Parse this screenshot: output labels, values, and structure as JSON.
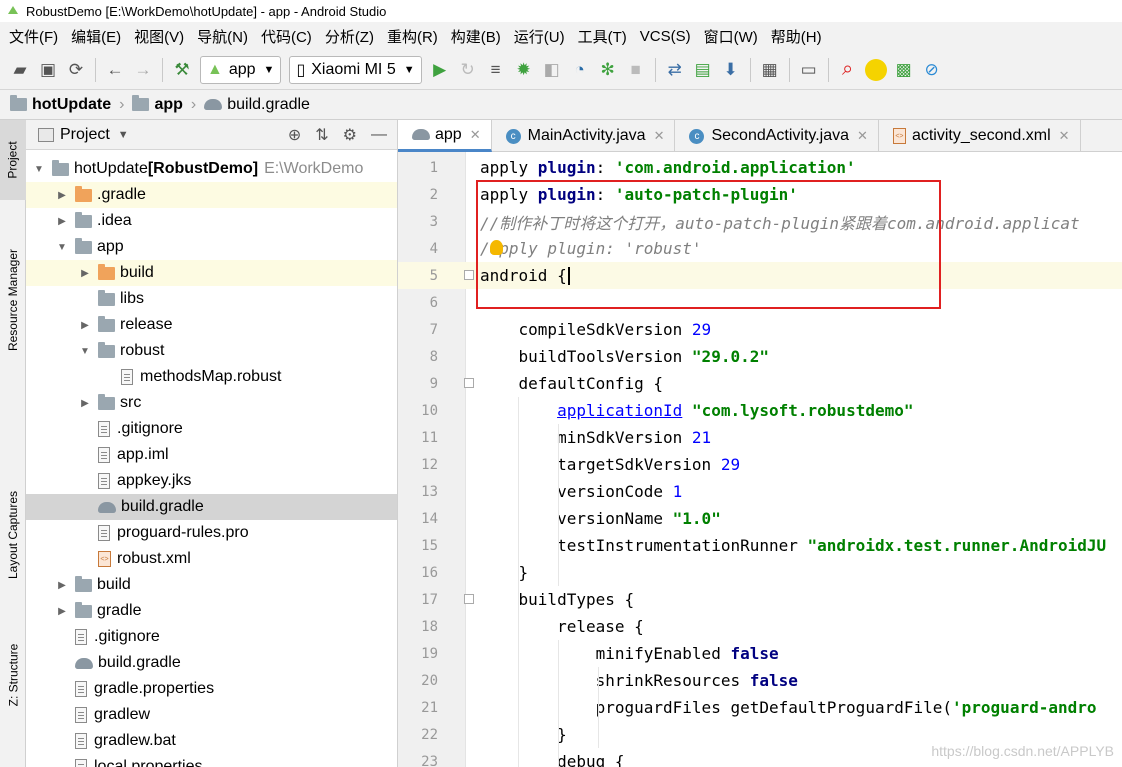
{
  "window": {
    "title": "RobustDemo [E:\\WorkDemo\\hotUpdate] - app - Android Studio"
  },
  "menu": [
    "文件(F)",
    "编辑(E)",
    "视图(V)",
    "导航(N)",
    "代码(C)",
    "分析(Z)",
    "重构(R)",
    "构建(B)",
    "运行(U)",
    "工具(T)",
    "VCS(S)",
    "窗口(W)",
    "帮助(H)"
  ],
  "toolbar": {
    "run_config": "app",
    "device": "Xiaomi MI 5"
  },
  "breadcrumb": [
    "hotUpdate",
    "app",
    "build.gradle"
  ],
  "left_tabs": [
    "Project",
    "Resource Manager",
    "Layout Captures",
    "Z: Structure"
  ],
  "project": {
    "header": "Project",
    "tree": [
      {
        "name": "hotUpdate",
        "bold": "[RobustDemo]",
        "path": "E:\\WorkDemo",
        "level": 0,
        "arrow": "open",
        "icon": "folder"
      },
      {
        "name": ".gradle",
        "level": 1,
        "arrow": "closed",
        "icon": "folder-orange",
        "hl": true
      },
      {
        "name": ".idea",
        "level": 1,
        "arrow": "closed",
        "icon": "folder"
      },
      {
        "name": "app",
        "level": 1,
        "arrow": "open",
        "icon": "folder"
      },
      {
        "name": "build",
        "level": 2,
        "arrow": "closed",
        "icon": "folder-orange",
        "hl": true
      },
      {
        "name": "libs",
        "level": 2,
        "arrow": "",
        "icon": "folder"
      },
      {
        "name": "release",
        "level": 2,
        "arrow": "closed",
        "icon": "folder"
      },
      {
        "name": "robust",
        "level": 2,
        "arrow": "open",
        "icon": "folder"
      },
      {
        "name": "methodsMap.robust",
        "level": 3,
        "arrow": "",
        "icon": "unknown"
      },
      {
        "name": "src",
        "level": 2,
        "arrow": "closed",
        "icon": "folder"
      },
      {
        "name": ".gitignore",
        "level": 2,
        "arrow": "",
        "icon": "file"
      },
      {
        "name": "app.iml",
        "level": 2,
        "arrow": "",
        "icon": "file"
      },
      {
        "name": "appkey.jks",
        "level": 2,
        "arrow": "",
        "icon": "file"
      },
      {
        "name": "build.gradle",
        "level": 2,
        "arrow": "",
        "icon": "gradle",
        "sel": true
      },
      {
        "name": "proguard-rules.pro",
        "level": 2,
        "arrow": "",
        "icon": "file"
      },
      {
        "name": "robust.xml",
        "level": 2,
        "arrow": "",
        "icon": "xml"
      },
      {
        "name": "build",
        "level": 1,
        "arrow": "closed",
        "icon": "folder"
      },
      {
        "name": "gradle",
        "level": 1,
        "arrow": "closed",
        "icon": "folder"
      },
      {
        "name": ".gitignore",
        "level": 1,
        "arrow": "",
        "icon": "file"
      },
      {
        "name": "build.gradle",
        "level": 1,
        "arrow": "",
        "icon": "gradle"
      },
      {
        "name": "gradle.properties",
        "level": 1,
        "arrow": "",
        "icon": "file"
      },
      {
        "name": "gradlew",
        "level": 1,
        "arrow": "",
        "icon": "file"
      },
      {
        "name": "gradlew.bat",
        "level": 1,
        "arrow": "",
        "icon": "file"
      },
      {
        "name": "local.properties",
        "level": 1,
        "arrow": "",
        "icon": "file"
      }
    ]
  },
  "tabs": [
    {
      "label": "app",
      "icon": "gradle",
      "active": true
    },
    {
      "label": "MainActivity.java",
      "icon": "class"
    },
    {
      "label": "SecondActivity.java",
      "icon": "class"
    },
    {
      "label": "activity_second.xml",
      "icon": "xml"
    }
  ],
  "code": [
    [
      {
        "t": "apply ",
        "c": ""
      },
      {
        "t": "plugin",
        "c": "kw"
      },
      {
        "t": ": ",
        "c": ""
      },
      {
        "t": "'com.android.application'",
        "c": "st"
      }
    ],
    [
      {
        "t": "apply ",
        "c": ""
      },
      {
        "t": "plugin",
        "c": "kw"
      },
      {
        "t": ": ",
        "c": ""
      },
      {
        "t": "'auto-patch-plugin'",
        "c": "st"
      }
    ],
    [
      {
        "t": "//制作补丁时将这个打开，auto-patch-plugin紧跟着com.android.applicat",
        "c": "cm"
      }
    ],
    [
      {
        "t": "/apply plugin: 'robust'",
        "c": "cm"
      }
    ],
    [
      {
        "t": "android ",
        "c": ""
      },
      {
        "t": "{",
        "c": ""
      }
    ],
    [],
    [
      {
        "t": "    compileSdkVersion ",
        "c": ""
      },
      {
        "t": "29",
        "c": "nm"
      }
    ],
    [
      {
        "t": "    buildToolsVersion ",
        "c": ""
      },
      {
        "t": "\"29.0.2\"",
        "c": "st"
      }
    ],
    [
      {
        "t": "    defaultConfig {",
        "c": ""
      }
    ],
    [
      {
        "t": "        ",
        "c": ""
      },
      {
        "t": "applicationId",
        "c": "lk"
      },
      {
        "t": " ",
        "c": ""
      },
      {
        "t": "\"com.lysoft.robustdemo\"",
        "c": "st"
      }
    ],
    [
      {
        "t": "        minSdkVersion ",
        "c": ""
      },
      {
        "t": "21",
        "c": "nm"
      }
    ],
    [
      {
        "t": "        targetSdkVersion ",
        "c": ""
      },
      {
        "t": "29",
        "c": "nm"
      }
    ],
    [
      {
        "t": "        versionCode ",
        "c": ""
      },
      {
        "t": "1",
        "c": "nm"
      }
    ],
    [
      {
        "t": "        versionName ",
        "c": ""
      },
      {
        "t": "\"1.0\"",
        "c": "st"
      }
    ],
    [
      {
        "t": "        testInstrumentationRunner ",
        "c": ""
      },
      {
        "t": "\"androidx.test.runner.AndroidJU",
        "c": "st"
      }
    ],
    [
      {
        "t": "    }",
        "c": ""
      }
    ],
    [
      {
        "t": "    buildTypes {",
        "c": ""
      }
    ],
    [
      {
        "t": "        release {",
        "c": ""
      }
    ],
    [
      {
        "t": "            minifyEnabled ",
        "c": ""
      },
      {
        "t": "false",
        "c": "kw"
      }
    ],
    [
      {
        "t": "            shrinkResources ",
        "c": ""
      },
      {
        "t": "false",
        "c": "kw"
      }
    ],
    [
      {
        "t": "            proguardFiles getDefaultProguardFile(",
        "c": ""
      },
      {
        "t": "'proguard-andro",
        "c": "st"
      }
    ],
    [
      {
        "t": "        }",
        "c": ""
      }
    ],
    [
      {
        "t": "        debug {",
        "c": ""
      }
    ]
  ],
  "current_line": 5,
  "watermark": "https://blog.csdn.net/APPLYB"
}
